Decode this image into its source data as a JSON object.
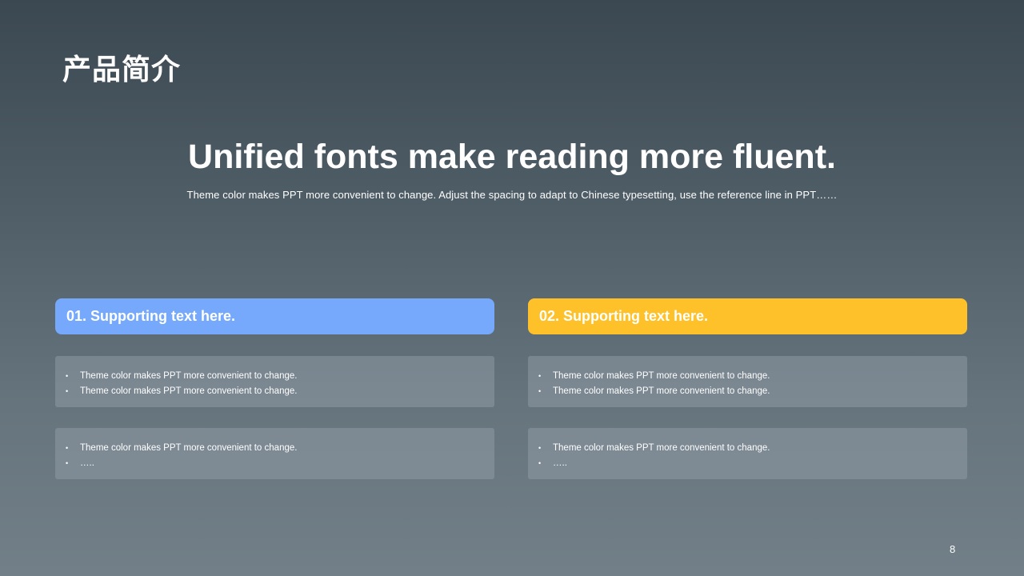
{
  "slide": {
    "title": "产品简介",
    "headline": "Unified fonts make reading more fluent.",
    "subline": "Theme color makes PPT more convenient to change. Adjust the spacing to adapt to Chinese typesetting, use the reference line in PPT……",
    "page_number": "8"
  },
  "columns": [
    {
      "header": "01. Supporting text here.",
      "color": "#76a9fb",
      "boxes": [
        {
          "items": [
            "Theme color makes PPT more convenient to change.",
            "Theme color makes PPT more convenient to change."
          ]
        },
        {
          "items": [
            "Theme color makes PPT more convenient to change.",
            "….."
          ]
        }
      ]
    },
    {
      "header": "02. Supporting text here.",
      "color": "#ffc12a",
      "boxes": [
        {
          "items": [
            "Theme color makes PPT more convenient to change.",
            "Theme color makes PPT more convenient to change."
          ]
        },
        {
          "items": [
            "Theme color makes PPT more convenient to change.",
            "….."
          ]
        }
      ]
    }
  ],
  "bullet_symbol": "•"
}
